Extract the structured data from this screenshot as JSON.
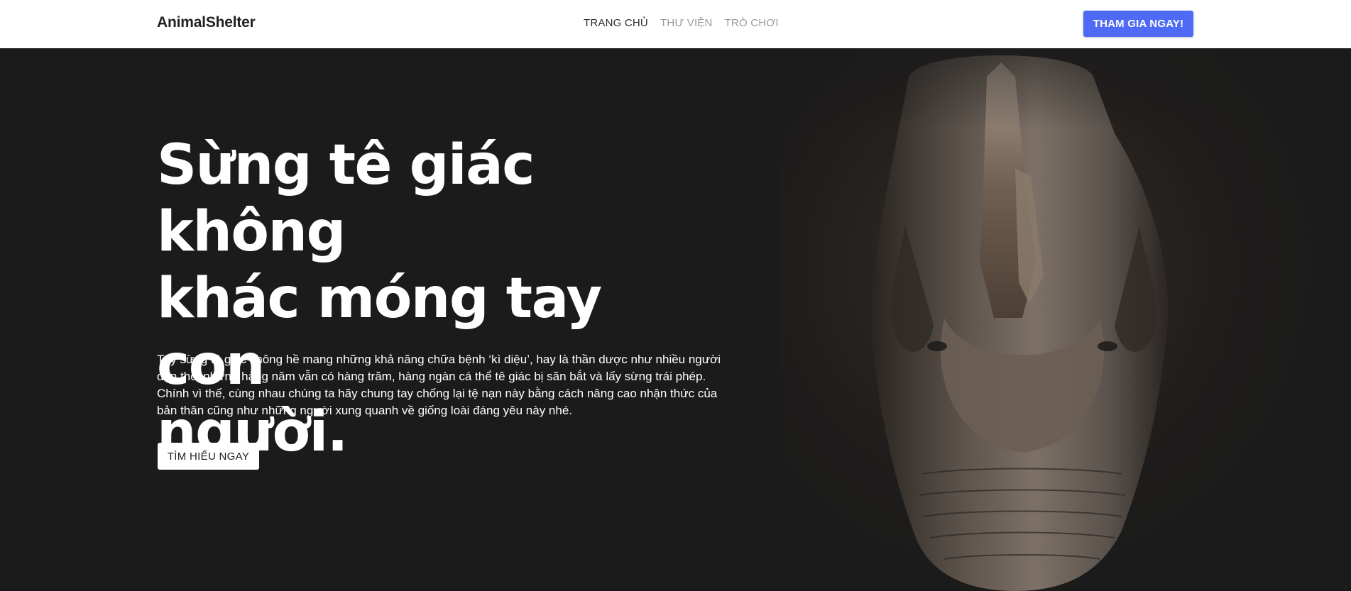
{
  "header": {
    "brand": "AnimalShelter",
    "nav": [
      {
        "label": "TRANG CHỦ",
        "active": true
      },
      {
        "label": "THƯ VIỆN",
        "active": false
      },
      {
        "label": "TRÒ CHƠI",
        "active": false
      }
    ],
    "cta_label": "THAM GIA NGAY!"
  },
  "hero": {
    "title_lines": [
      "Sừng tê giác không",
      "khác móng tay con",
      "người."
    ],
    "description_lines": [
      "Tuy sừng tê giác không hề mang những khả năng chữa bệnh ‘kì diệu’, hay là thần dược như nhiều người",
      "đồn thổi nhưng hàng năm vẫn có hàng trăm, hàng ngàn cá thể tê giác bị săn bắt và lấy sừng trái phép.",
      "Chính vì thế, cùng nhau chúng ta hãy chung tay chống lại tệ nạn này bằng cách nâng cao nhận thức của",
      "bản thân cũng như những người xung quanh về giống loài đáng yêu này nhé."
    ],
    "button_label": "TÌM HIỂU NGAY",
    "image": "rhino-head-photo"
  },
  "colors": {
    "accent": "#4f6bf5",
    "hero_background": "#1b1b1b",
    "header_background": "#ffffff"
  }
}
